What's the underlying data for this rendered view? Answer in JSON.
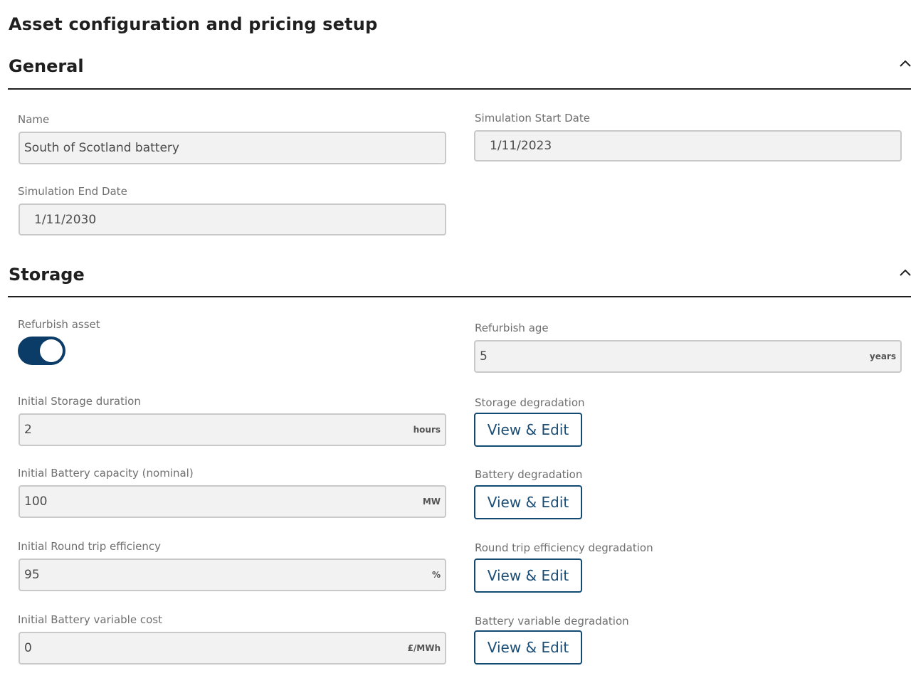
{
  "page": {
    "title": "Asset configuration and pricing setup"
  },
  "general": {
    "title": "General",
    "collapse_icon": "chevron-up-icon",
    "name": {
      "label": "Name",
      "value": "South of Scotland battery"
    },
    "start_date": {
      "label": "Simulation Start Date",
      "value": "1/11/2023"
    },
    "end_date": {
      "label": "Simulation End Date",
      "value": "1/11/2030"
    }
  },
  "storage": {
    "title": "Storage",
    "collapse_icon": "chevron-up-icon",
    "refurbish_asset": {
      "label": "Refurbish asset",
      "enabled": true
    },
    "refurbish_age": {
      "label": "Refurbish age",
      "value": "5",
      "unit": "years"
    },
    "storage_duration": {
      "label": "Initial Storage duration",
      "value": "2",
      "unit": "hours"
    },
    "storage_degradation": {
      "label": "Storage degradation",
      "button": "View & Edit"
    },
    "battery_capacity": {
      "label": "Initial Battery capacity (nominal)",
      "value": "100",
      "unit": "MW"
    },
    "battery_degradation": {
      "label": "Battery degradation",
      "button": "View & Edit"
    },
    "round_trip_efficiency": {
      "label": "Initial Round trip efficiency",
      "value": "95",
      "unit": "%"
    },
    "rte_degradation": {
      "label": "Round trip efficiency degradation",
      "button": "View & Edit"
    },
    "variable_cost": {
      "label": "Initial Battery variable cost",
      "value": "0",
      "unit": "£/MWh"
    },
    "variable_degradation": {
      "label": "Battery variable degradation",
      "button": "View & Edit"
    }
  },
  "colors": {
    "accent": "#0b3c68",
    "button_border": "#124a72",
    "input_background": "#f2f2f2",
    "input_border": "#c9c9c9",
    "label": "#6f6f6f"
  }
}
